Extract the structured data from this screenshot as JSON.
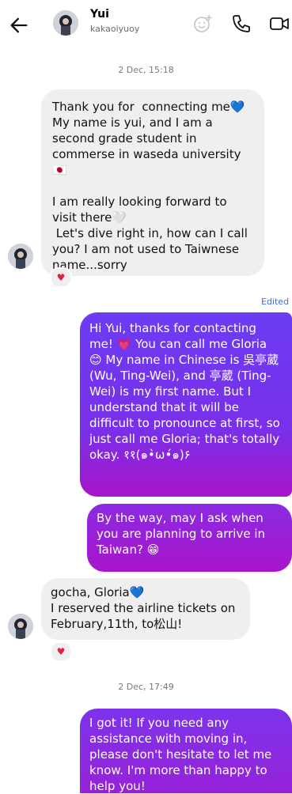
{
  "header": {
    "name": "Yui",
    "username": "kakaoiyuoy"
  },
  "timestamps": [
    "2 Dec, 15:18",
    "2 Dec, 17:49"
  ],
  "messages": [
    {
      "sender": "Yui",
      "direction": "incoming",
      "text": "Thank you for  connecting me💙\nMy name is yui, and I am a second grade student in commerse in waseda university🇯🇵\n\nI am really looking forward to visit there🤍\n Let's dive right in, how can I call you? I am not used to Taiwnese name...sorry",
      "reaction": "♥"
    },
    {
      "sender": "me",
      "direction": "outgoing",
      "edited_label": "Edited",
      "text": "Hi Yui, thanks for contacting me! 💗 You can call me Gloria 😊 My name in Chinese is 吳亭葳(Wu, Ting-Wei), and 亭葳 (Ting-Wei) is my first name. But I understand that it will be difficult to pronounce at first, so just call me Gloria; that's totally okay. ११(๑•̀ω•́๑)۶"
    },
    {
      "sender": "me",
      "direction": "outgoing",
      "text": "By the way, may I ask when you are planning to arrive in Taiwan? 😁"
    },
    {
      "sender": "Yui",
      "direction": "incoming",
      "text": "gocha, Gloria💙\nI reserved the airline tickets on February,11th, to松山!",
      "reaction": "♥"
    },
    {
      "sender": "me",
      "direction": "outgoing",
      "text": "I got it! If you need any assistance with moving in, please don't hesitate to let me know. I'm more than happy to help you!"
    }
  ],
  "colors": {
    "outgoing_top": "#6a3cf3",
    "outgoing_bottom": "#a914c9",
    "incoming_bg": "#efefef",
    "edited": "#3d70d8",
    "reaction": "#e0224a"
  },
  "icons": [
    "back-arrow-icon",
    "add-emoji-icon",
    "phone-icon",
    "video-call-icon",
    "heart-icon"
  ]
}
